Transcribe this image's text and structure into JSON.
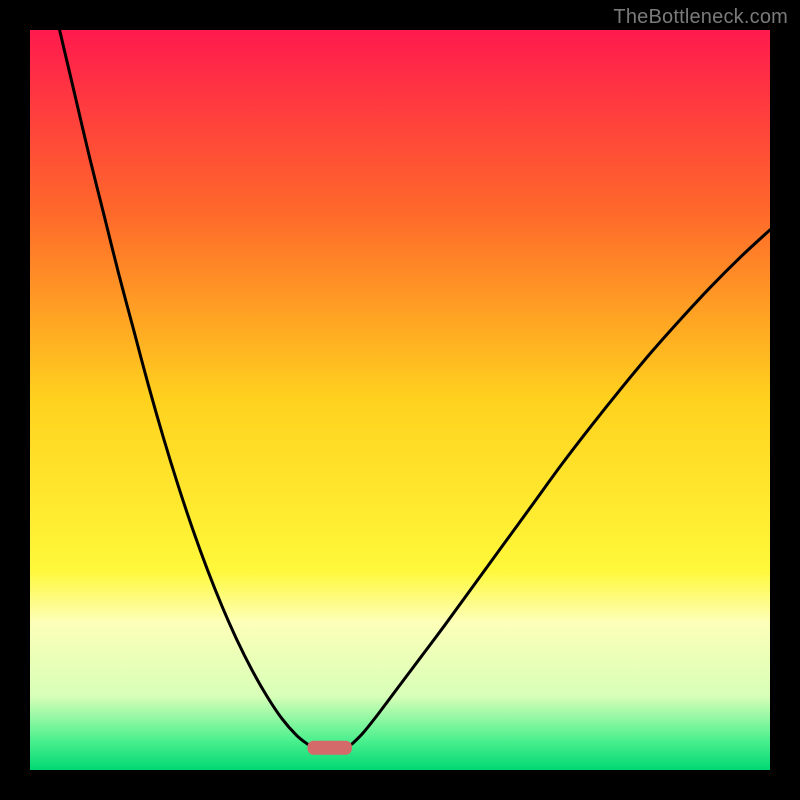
{
  "watermark": "TheBottleneck.com",
  "chart_data": {
    "type": "line",
    "title": "",
    "xlabel": "",
    "ylabel": "",
    "xlim": [
      0,
      100
    ],
    "ylim": [
      0,
      100
    ],
    "grid": false,
    "legend": false,
    "background_gradient": {
      "stops": [
        {
          "offset": 0,
          "color": "#ff1a4d"
        },
        {
          "offset": 25,
          "color": "#ff6a2a"
        },
        {
          "offset": 50,
          "color": "#ffd21e"
        },
        {
          "offset": 73,
          "color": "#fff83a"
        },
        {
          "offset": 80,
          "color": "#fdffb8"
        },
        {
          "offset": 90,
          "color": "#d8ffb8"
        },
        {
          "offset": 96,
          "color": "#4cf08e"
        },
        {
          "offset": 100,
          "color": "#00d873"
        }
      ]
    },
    "marker": {
      "x_center": 40.5,
      "y": 97,
      "width": 6,
      "color": "#d46a6a"
    },
    "series": [
      {
        "name": "left-curve",
        "x": [
          4,
          6,
          8,
          10,
          12,
          14,
          16,
          18,
          20,
          22,
          24,
          26,
          28,
          30,
          32,
          34,
          36,
          37.5
        ],
        "y": [
          0,
          8.5,
          17,
          25,
          33,
          40.5,
          48,
          55,
          61.5,
          67.5,
          73,
          78,
          82.5,
          86.5,
          90,
          93,
          95.3,
          96.5
        ]
      },
      {
        "name": "right-curve",
        "x": [
          43.5,
          45,
          47,
          50,
          53,
          56,
          60,
          64,
          68,
          72,
          76,
          80,
          84,
          88,
          92,
          96,
          100
        ],
        "y": [
          96.5,
          95,
          92.5,
          88.5,
          84.5,
          80.5,
          75,
          69.5,
          64,
          58.5,
          53.3,
          48.3,
          43.5,
          39,
          34.7,
          30.7,
          27
        ]
      }
    ]
  }
}
